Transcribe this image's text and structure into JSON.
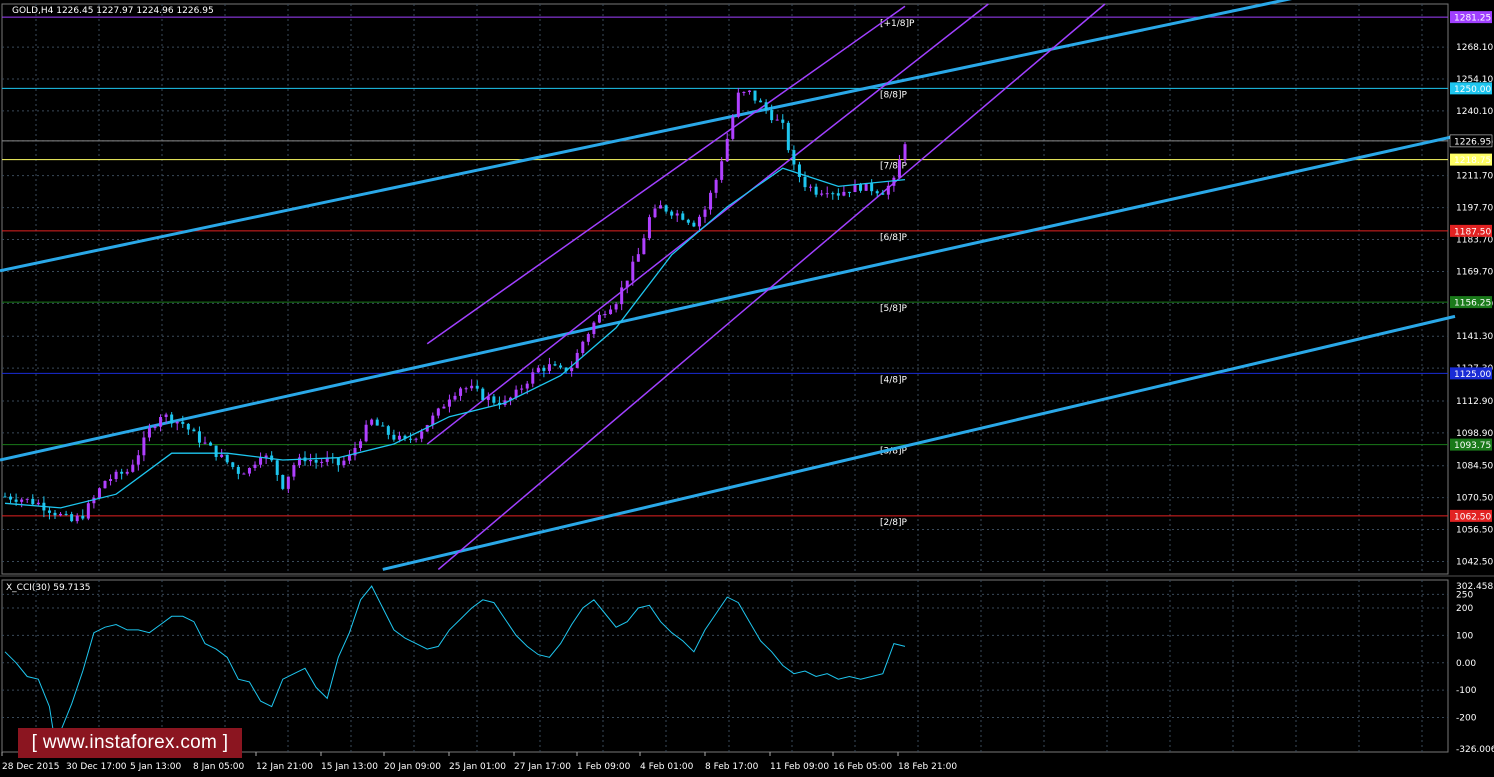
{
  "chart_data": {
    "type": "candlestick",
    "symbol_header": "GOLD,H4  1226.45 1227.97 1224.96 1226.95",
    "price_axis": {
      "range": [
        1037,
        1287
      ],
      "ticks": [
        "1268.10",
        "1254.10",
        "1240.10",
        "1226.95",
        "1211.70",
        "1197.70",
        "1183.70",
        "1169.70",
        "1155.70",
        "1141.30",
        "1127.30",
        "1112.90",
        "1098.90",
        "1084.50",
        "1070.50",
        "1056.50",
        "1042.50"
      ],
      "tick_values": [
        1268.1,
        1254.1,
        1240.1,
        1226.95,
        1211.7,
        1197.7,
        1183.7,
        1169.7,
        1155.7,
        1141.3,
        1127.3,
        1112.9,
        1098.9,
        1084.5,
        1070.5,
        1056.5,
        1042.5
      ]
    },
    "murrey_levels": [
      {
        "label": "[+1/8]P",
        "value": 1281.25,
        "price_label": "1281.25",
        "color": "#a040ff"
      },
      {
        "label": "[8/8]P",
        "value": 1250.0,
        "price_label": "1250.00",
        "color": "#1ec6ef"
      },
      {
        "label": "[7/8]P",
        "value": 1218.75,
        "price_label": "1218.75",
        "color": "#ffff66"
      },
      {
        "label": "[6/8]P",
        "value": 1187.5,
        "price_label": "1187.50",
        "color": "#e22222"
      },
      {
        "label": "[5/8]P",
        "value": 1156.25,
        "price_label": "1156.25",
        "color": "#1a7a1a"
      },
      {
        "label": "[4/8]P",
        "value": 1125.0,
        "price_label": "1125.00",
        "color": "#1a2cd6"
      },
      {
        "label": "[3/8]P",
        "value": 1093.75,
        "price_label": "1093.75",
        "color": "#1a7a1a"
      },
      {
        "label": "[2/8]P",
        "value": 1062.5,
        "price_label": "1062.50",
        "color": "#e22222"
      }
    ],
    "current_price": {
      "value": 1226.95,
      "label": "1226.95"
    },
    "time_axis": [
      "28 Dec 2015",
      "30 Dec 17:00",
      "5 Jan 13:00",
      "8 Jan 05:00",
      "12 Jan 21:00",
      "15 Jan 13:00",
      "20 Jan 09:00",
      "25 Jan 01:00",
      "27 Jan 17:00",
      "1 Feb 09:00",
      "4 Feb 01:00",
      "8 Feb 17:00",
      "11 Feb 09:00",
      "16 Feb 05:00",
      "18 Feb 21:00"
    ],
    "close_path": [
      [
        0,
        1071
      ],
      [
        3,
        1070
      ],
      [
        6,
        1068
      ],
      [
        9,
        1064
      ],
      [
        12,
        1060
      ],
      [
        14,
        1063
      ],
      [
        16,
        1070
      ],
      [
        18,
        1078
      ],
      [
        20,
        1080
      ],
      [
        22,
        1082
      ],
      [
        24,
        1090
      ],
      [
        26,
        1100
      ],
      [
        28,
        1107
      ],
      [
        30,
        1105
      ],
      [
        32,
        1103
      ],
      [
        34,
        1098
      ],
      [
        36,
        1094
      ],
      [
        38,
        1090
      ],
      [
        40,
        1086
      ],
      [
        42,
        1082
      ],
      [
        44,
        1083
      ],
      [
        46,
        1090
      ],
      [
        48,
        1086
      ],
      [
        50,
        1076
      ],
      [
        52,
        1085
      ],
      [
        54,
        1088
      ],
      [
        56,
        1086
      ],
      [
        58,
        1087
      ],
      [
        60,
        1085
      ],
      [
        62,
        1088
      ],
      [
        64,
        1097
      ],
      [
        66,
        1104
      ],
      [
        68,
        1100
      ],
      [
        70,
        1097
      ],
      [
        72,
        1095
      ],
      [
        74,
        1098
      ],
      [
        76,
        1103
      ],
      [
        78,
        1108
      ],
      [
        80,
        1115
      ],
      [
        82,
        1119
      ],
      [
        84,
        1118
      ],
      [
        86,
        1115
      ],
      [
        88,
        1113
      ],
      [
        90,
        1112
      ],
      [
        92,
        1116
      ],
      [
        94,
        1122
      ],
      [
        96,
        1127
      ],
      [
        98,
        1128
      ],
      [
        100,
        1126
      ],
      [
        102,
        1128
      ],
      [
        104,
        1139
      ],
      [
        106,
        1147
      ],
      [
        108,
        1153
      ],
      [
        110,
        1157
      ],
      [
        112,
        1167
      ],
      [
        114,
        1177
      ],
      [
        116,
        1193
      ],
      [
        118,
        1198
      ],
      [
        120,
        1196
      ],
      [
        122,
        1194
      ],
      [
        124,
        1191
      ],
      [
        126,
        1197
      ],
      [
        128,
        1210
      ],
      [
        130,
        1228
      ],
      [
        132,
        1247
      ],
      [
        134,
        1248
      ],
      [
        136,
        1243
      ],
      [
        138,
        1238
      ],
      [
        140,
        1233
      ],
      [
        142,
        1215
      ],
      [
        144,
        1208
      ],
      [
        146,
        1205
      ],
      [
        148,
        1206
      ],
      [
        150,
        1204
      ],
      [
        152,
        1206
      ],
      [
        154,
        1207
      ],
      [
        156,
        1206
      ],
      [
        158,
        1205
      ],
      [
        160,
        1209
      ],
      [
        162,
        1227
      ]
    ],
    "ma_path": [
      [
        0,
        1068
      ],
      [
        10,
        1066
      ],
      [
        20,
        1072
      ],
      [
        30,
        1090
      ],
      [
        40,
        1090
      ],
      [
        50,
        1087
      ],
      [
        60,
        1088
      ],
      [
        70,
        1094
      ],
      [
        80,
        1106
      ],
      [
        90,
        1112
      ],
      [
        100,
        1124
      ],
      [
        110,
        1145
      ],
      [
        120,
        1177
      ],
      [
        130,
        1198
      ],
      [
        140,
        1215
      ],
      [
        150,
        1207
      ],
      [
        162,
        1210
      ]
    ],
    "cci": {
      "label": "X_CCI(30) 59.7135",
      "axis_ticks": [
        "302.4585",
        "250",
        "200",
        "100",
        "0.00",
        "-100",
        "-200",
        "-326.0061"
      ],
      "axis_values": [
        302.4585,
        250,
        200,
        100,
        0,
        -100,
        -200,
        -326.0061
      ],
      "range": [
        -326.0061,
        302.4585
      ],
      "path": [
        [
          0,
          40
        ],
        [
          2,
          0
        ],
        [
          4,
          -50
        ],
        [
          6,
          -60
        ],
        [
          8,
          -160
        ],
        [
          9,
          -290
        ],
        [
          10,
          -250
        ],
        [
          12,
          -150
        ],
        [
          14,
          -30
        ],
        [
          16,
          110
        ],
        [
          18,
          130
        ],
        [
          20,
          140
        ],
        [
          22,
          120
        ],
        [
          24,
          120
        ],
        [
          26,
          110
        ],
        [
          28,
          140
        ],
        [
          30,
          170
        ],
        [
          32,
          170
        ],
        [
          34,
          150
        ],
        [
          36,
          70
        ],
        [
          38,
          50
        ],
        [
          40,
          20
        ],
        [
          42,
          -60
        ],
        [
          44,
          -70
        ],
        [
          46,
          -140
        ],
        [
          48,
          -160
        ],
        [
          50,
          -60
        ],
        [
          52,
          -40
        ],
        [
          54,
          -20
        ],
        [
          56,
          -90
        ],
        [
          58,
          -130
        ],
        [
          60,
          20
        ],
        [
          62,
          110
        ],
        [
          64,
          230
        ],
        [
          66,
          280
        ],
        [
          68,
          200
        ],
        [
          70,
          120
        ],
        [
          72,
          90
        ],
        [
          74,
          70
        ],
        [
          76,
          50
        ],
        [
          78,
          60
        ],
        [
          80,
          120
        ],
        [
          82,
          160
        ],
        [
          84,
          200
        ],
        [
          86,
          230
        ],
        [
          88,
          220
        ],
        [
          90,
          160
        ],
        [
          92,
          100
        ],
        [
          94,
          60
        ],
        [
          96,
          30
        ],
        [
          98,
          20
        ],
        [
          100,
          70
        ],
        [
          102,
          140
        ],
        [
          104,
          200
        ],
        [
          106,
          230
        ],
        [
          108,
          180
        ],
        [
          110,
          130
        ],
        [
          112,
          150
        ],
        [
          114,
          200
        ],
        [
          116,
          210
        ],
        [
          118,
          150
        ],
        [
          120,
          110
        ],
        [
          122,
          80
        ],
        [
          124,
          40
        ],
        [
          126,
          120
        ],
        [
          128,
          180
        ],
        [
          130,
          240
        ],
        [
          132,
          220
        ],
        [
          134,
          150
        ],
        [
          136,
          80
        ],
        [
          138,
          40
        ],
        [
          140,
          -10
        ],
        [
          142,
          -40
        ],
        [
          144,
          -30
        ],
        [
          146,
          -50
        ],
        [
          148,
          -40
        ],
        [
          150,
          -60
        ],
        [
          152,
          -50
        ],
        [
          154,
          -60
        ],
        [
          156,
          -50
        ],
        [
          158,
          -40
        ],
        [
          160,
          70
        ],
        [
          162,
          60
        ]
      ]
    }
  },
  "watermark": "[ www.instaforex.com ]",
  "colors": {
    "background": "#000000",
    "grid": "#3a4a5a",
    "bull_candle": "#b040ff",
    "bear_candle": "#1ec6ef",
    "ma": "#1ec6ef",
    "channel_purple": "#a040ff",
    "trend_blue": "#2aa8e8",
    "cci_line": "#1ec6ef"
  }
}
